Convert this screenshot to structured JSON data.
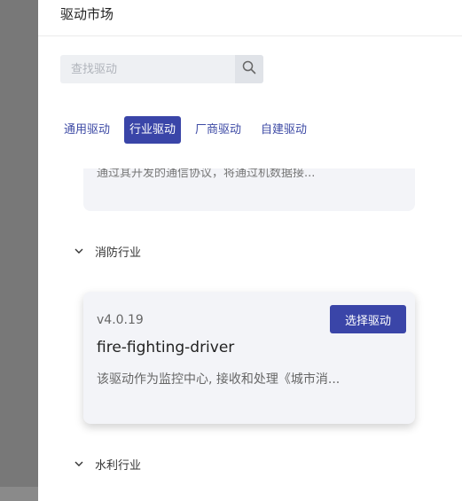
{
  "drawer": {
    "title": "驱动市场"
  },
  "search": {
    "placeholder": "查找驱动",
    "value": ""
  },
  "tabs": [
    {
      "label": "通用驱动",
      "active": false
    },
    {
      "label": "行业驱动",
      "active": true
    },
    {
      "label": "厂商驱动",
      "active": false
    },
    {
      "label": "自建驱动",
      "active": false
    }
  ],
  "previous_card": {
    "description": "通过其开发的通信协议，将通过机数据接..."
  },
  "groups": [
    {
      "label": "消防行业",
      "expanded": true,
      "cards": [
        {
          "version": "v4.0.19",
          "name": "fire-fighting-driver",
          "description": "该驱动作为监控中心, 接收和处理《城市消...",
          "button_label": "选择驱动"
        }
      ]
    },
    {
      "label": "水利行业",
      "expanded": false
    }
  ],
  "colors": {
    "accent": "#3a45a8",
    "card_bg": "#f3f4f8",
    "overlay": "#787878"
  }
}
